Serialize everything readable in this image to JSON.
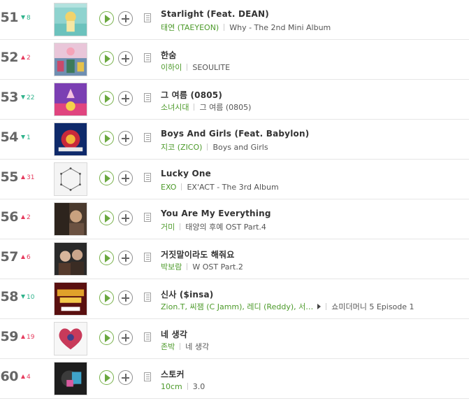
{
  "rows": [
    {
      "rank": "51",
      "dir": "down",
      "change": "8",
      "title": "Starlight (Feat. DEAN)",
      "artist": "태연 (TAEYEON)",
      "album": "Why - The 2nd Mini Album",
      "more": false,
      "cover": "cover-taeyeon-why"
    },
    {
      "rank": "52",
      "dir": "up",
      "change": "2",
      "title": "한숨",
      "artist": "이하이",
      "album": "SEOULITE",
      "more": false,
      "cover": "cover-seoulite"
    },
    {
      "rank": "53",
      "dir": "down",
      "change": "22",
      "title": "그 여름 (0805)",
      "artist": "소녀시대",
      "album": "그 여름 (0805)",
      "more": false,
      "cover": "cover-that-summer"
    },
    {
      "rank": "54",
      "dir": "down",
      "change": "1",
      "title": "Boys And Girls (Feat. Babylon)",
      "artist": "지코 (ZICO)",
      "album": "Boys and Girls",
      "more": false,
      "cover": "cover-boys-and-girls"
    },
    {
      "rank": "55",
      "dir": "up",
      "change": "31",
      "title": "Lucky One",
      "artist": "EXO",
      "album": "EX'ACT - The 3rd Album",
      "more": false,
      "cover": "cover-exact"
    },
    {
      "rank": "56",
      "dir": "up",
      "change": "2",
      "title": "You Are My Everything",
      "artist": "거미",
      "album": "태양의 후예 OST Part.4",
      "more": false,
      "cover": "cover-dots-ost"
    },
    {
      "rank": "57",
      "dir": "up",
      "change": "6",
      "title": "거짓말이라도 해줘요",
      "artist": "박보람",
      "album": "W OST Part.2",
      "more": false,
      "cover": "cover-w-ost"
    },
    {
      "rank": "58",
      "dir": "down",
      "change": "10",
      "title": "신사 ($insa)",
      "artist": "Zion.T, 씨잼 (C Jamm), 레디 (Reddy), 서…",
      "album": "쇼미더머니 5 Episode 1",
      "more": true,
      "cover": "cover-smtm5"
    },
    {
      "rank": "59",
      "dir": "up",
      "change": "19",
      "title": "네 생각",
      "artist": "존박",
      "album": "네 생각",
      "more": false,
      "cover": "cover-your-thoughts"
    },
    {
      "rank": "60",
      "dir": "up",
      "change": "4",
      "title": "스토커",
      "artist": "10cm",
      "album": "3.0",
      "more": false,
      "cover": "cover-10cm-3"
    }
  ],
  "colors": {
    "rank": "#666666",
    "rise": "#e63b5e",
    "fall": "#2fb38b",
    "artist": "#4c9a2a",
    "play": "#6aa83f",
    "divider": "#e6e6e6"
  },
  "icons": {
    "rise": "arrow-up-icon",
    "fall": "arrow-down-icon",
    "play": "play-icon",
    "add": "plus-icon",
    "lyrics": "lyrics-document-icon",
    "more_artists": "more-artists-triangle-icon"
  }
}
